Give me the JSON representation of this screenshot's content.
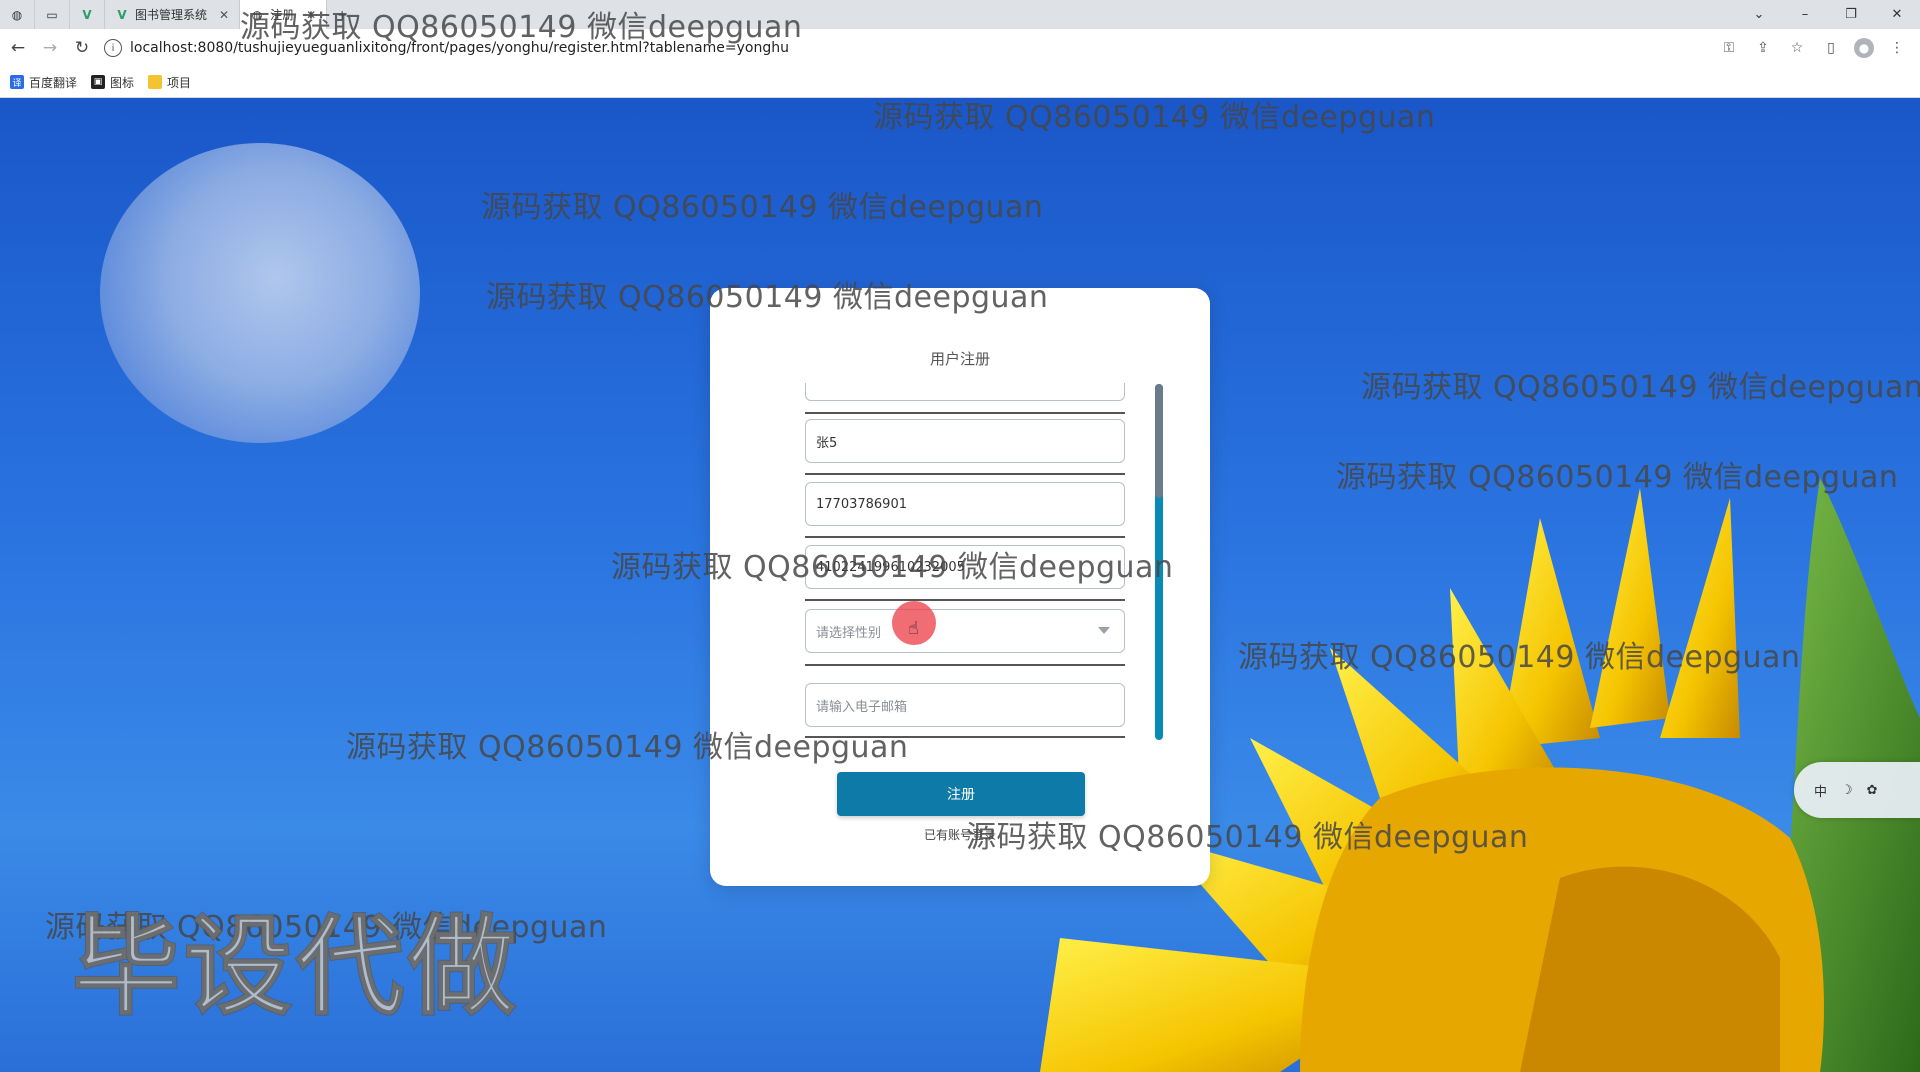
{
  "browser": {
    "tabs": [
      {
        "label": "",
        "icon": "globe-icon"
      },
      {
        "label": "",
        "icon": "blank-tab-icon"
      },
      {
        "label": "",
        "icon": "vue-icon"
      },
      {
        "label": "图书管理系统",
        "icon": "vue-icon"
      },
      {
        "label": "注册",
        "icon": "globe-icon",
        "active": true
      }
    ],
    "new_tab": "+",
    "url": "localhost:8080/tushujieyueguanlixitong/front/pages/yonghu/register.html?tablename=yonghu",
    "bookmarks": [
      {
        "label": "百度翻译",
        "icon": "translate-icon",
        "color": "#2b6be6"
      },
      {
        "label": "图标",
        "icon": "image-icon",
        "color": "#222222"
      },
      {
        "label": "项目",
        "icon": "folder-icon",
        "color": "#f4c430"
      }
    ]
  },
  "form": {
    "title": "用户注册",
    "fields": [
      {
        "name": "name-field",
        "value": "张5",
        "placeholder": ""
      },
      {
        "name": "phone-field",
        "value": "17703786901",
        "placeholder": ""
      },
      {
        "name": "id-card-field",
        "value": "410224199610232005",
        "placeholder": ""
      },
      {
        "name": "gender-select",
        "value": "",
        "placeholder": "请选择性别"
      },
      {
        "name": "email-field",
        "value": "",
        "placeholder": "请输入电子邮箱"
      }
    ],
    "register_button": "注册",
    "login_link": "已有账号登录"
  },
  "overlays": {
    "watermark_text": "源码获取 QQ86050149 微信deepguan",
    "stamp_text": "毕设代做",
    "ime_label": "中"
  },
  "colors": {
    "primary_button": "#0e7aa8",
    "scroll_track": "#0a8bb6",
    "scroll_thumb": "#6d7a8c"
  }
}
